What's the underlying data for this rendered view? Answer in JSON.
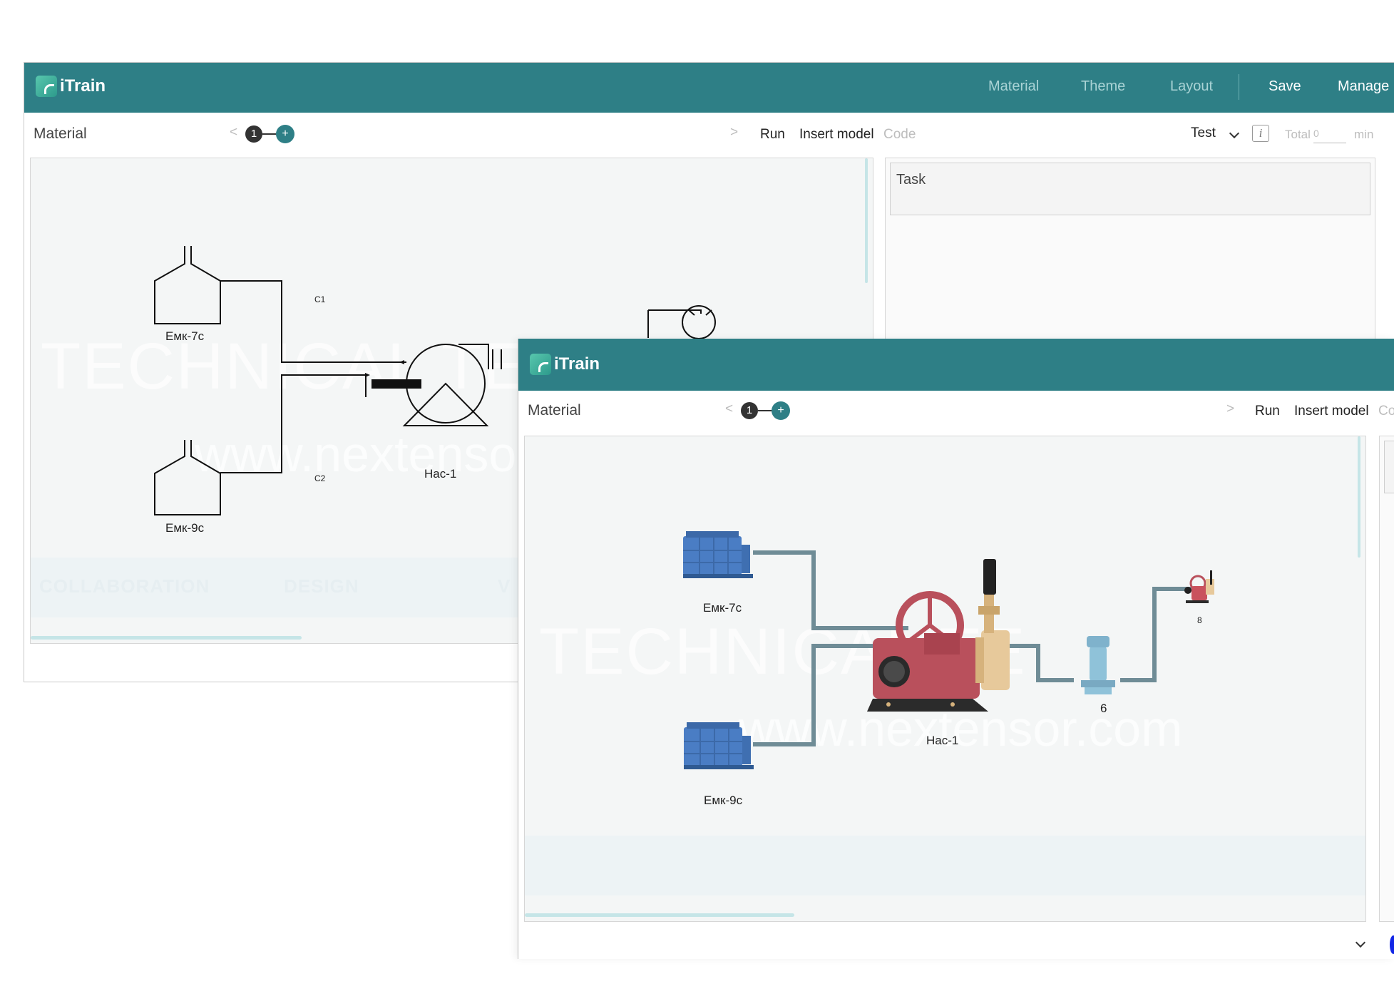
{
  "app": {
    "name": "iTrain"
  },
  "nav": {
    "material": "Material",
    "theme": "Theme",
    "layout": "Layout",
    "save": "Save",
    "manage": "Manage"
  },
  "toolbar": {
    "material": "Material",
    "prev": "<",
    "step": "1",
    "add": "+",
    "next": ">",
    "run": "Run",
    "insert_model": "Insert model",
    "code": "Code",
    "mode": "Test",
    "info": "i",
    "total": "Total",
    "total_value": "0",
    "min": "min"
  },
  "task": {
    "title": "Task"
  },
  "watermark": {
    "line1": "TECHNICAL TE",
    "line2": "www.nextensor.com",
    "tabs": [
      "COLLABORATION",
      "DESIGN",
      "V"
    ]
  },
  "schematic": {
    "tank_top": "Емк-7с",
    "tank_bottom": "Емк-9с",
    "pump": "Нас-1",
    "line1": "C1",
    "line2": "C2"
  },
  "model": {
    "tank_top": "Емк-7с",
    "tank_bottom": "Емк-9с",
    "pump": "Нас-1",
    "component6": "6",
    "component8": "8"
  },
  "colors": {
    "header": "#2e7f86",
    "accent": "#2e7f86",
    "tank": "#4a7dc4",
    "pump": "#b9505c",
    "brass": "#e7c99b"
  }
}
